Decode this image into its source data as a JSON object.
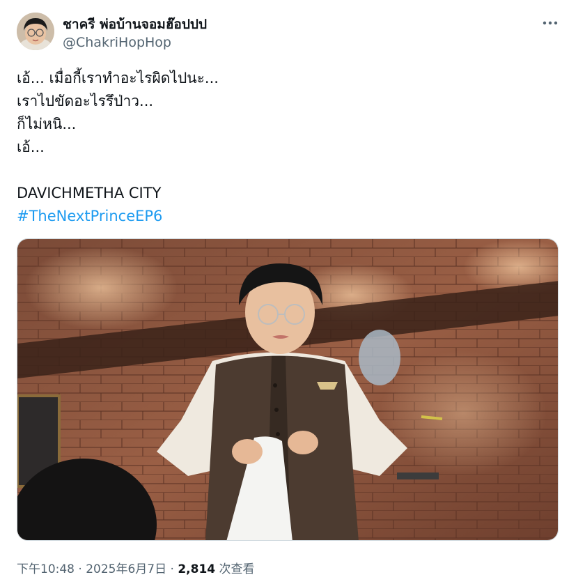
{
  "author": {
    "display_name": "ชาครี พ่อบ้านจอมฮ๊อปปป",
    "handle": "@ChakriHopHop",
    "avatar_icon": "avatar-photo"
  },
  "more_icon": "more-horizontal-icon",
  "tweet": {
    "lines": [
      "เอ้... เมื่อกี้เราทำอะไรผิดไปนะ...",
      "เราไปขัดอะไรรึป่าว...",
      "ก็ไม่หนิ...",
      "เอ้..."
    ],
    "tagline": "DAVICHMETHA CITY",
    "hashtag": "#TheNextPrinceEP6"
  },
  "media": {
    "description_icon": "video-still-image"
  },
  "meta": {
    "time": "下午10:48",
    "separator": " · ",
    "date": "2025年6月7日",
    "views_count": "2,814",
    "views_label": " 次查看"
  },
  "colors": {
    "link": "#1d9bf0",
    "secondary_text": "#536471",
    "primary_text": "#0f1419"
  }
}
